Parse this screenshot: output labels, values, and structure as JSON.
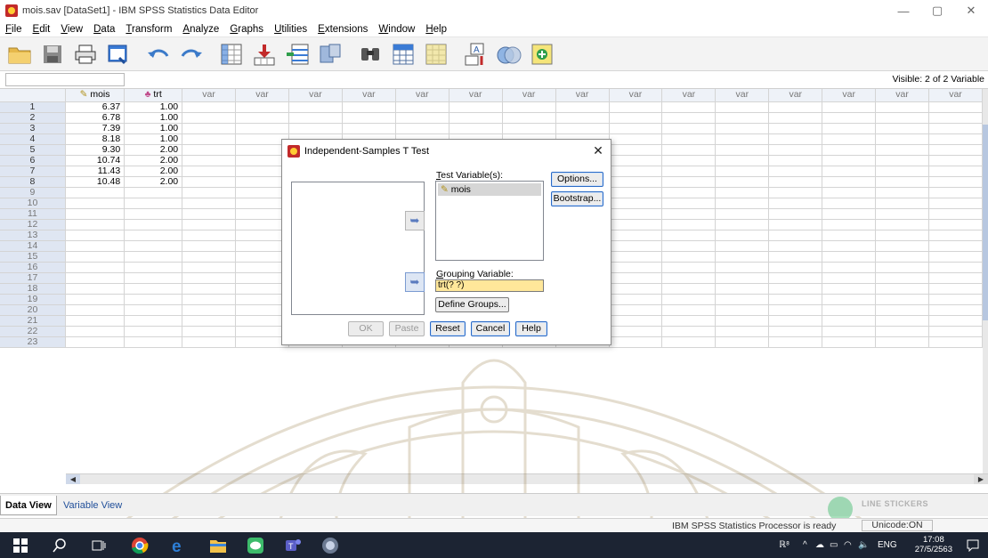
{
  "window": {
    "title": "mois.sav [DataSet1] - IBM SPSS Statistics Data Editor",
    "controls": {
      "minimize": "—",
      "maximize": "▢",
      "close": "✕"
    }
  },
  "menu": [
    "File",
    "Edit",
    "View",
    "Data",
    "Transform",
    "Analyze",
    "Graphs",
    "Utilities",
    "Extensions",
    "Window",
    "Help"
  ],
  "toolbar": [
    "open-folder-icon",
    "save-icon",
    "print-icon",
    "dialog-recall-icon",
    "undo-icon",
    "redo-icon",
    "goto-case-icon",
    "goto-variable-icon",
    "variables-icon",
    "run-descriptives-icon",
    "find-icon",
    "insert-cases-icon",
    "insert-variable-icon",
    "split-file-icon",
    "select-cases-icon",
    "value-labels-icon"
  ],
  "editor": {
    "visible": "Visible: 2 of 2 Variable"
  },
  "grid": {
    "columns": [
      {
        "label": "mois",
        "type": "scale"
      },
      {
        "label": "trt",
        "type": "nominal"
      },
      {
        "label": "var"
      },
      {
        "label": "var"
      },
      {
        "label": "var"
      },
      {
        "label": "var"
      },
      {
        "label": "var"
      },
      {
        "label": "var"
      },
      {
        "label": "var"
      },
      {
        "label": "var"
      },
      {
        "label": "var"
      },
      {
        "label": "var"
      },
      {
        "label": "var"
      },
      {
        "label": "var"
      },
      {
        "label": "var"
      },
      {
        "label": "var"
      },
      {
        "label": "var"
      }
    ],
    "rows": [
      [
        "6.37",
        "1.00"
      ],
      [
        "6.78",
        "1.00"
      ],
      [
        "7.39",
        "1.00"
      ],
      [
        "8.18",
        "1.00"
      ],
      [
        "9.30",
        "2.00"
      ],
      [
        "10.74",
        "2.00"
      ],
      [
        "11.43",
        "2.00"
      ],
      [
        "10.48",
        "2.00"
      ],
      [],
      [],
      [],
      [],
      [],
      [],
      [],
      [],
      [],
      [],
      [],
      [],
      [],
      [],
      []
    ]
  },
  "tabs": {
    "data_view": "Data View",
    "variable_view": "Variable View"
  },
  "status": {
    "processor": "IBM SPSS Statistics Processor is ready",
    "unicode": "Unicode:ON"
  },
  "sticker": {
    "brand": "LINE STICKERS"
  },
  "dialog": {
    "title": "Independent-Samples T Test",
    "test_label": "Test Variable(s):",
    "test_items": [
      "mois"
    ],
    "grouping_label": "Grouping Variable:",
    "grouping_value": "trt(? ?)",
    "define_groups": "Define Groups...",
    "options": "Options...",
    "bootstrap": "Bootstrap...",
    "ok": "OK",
    "paste": "Paste",
    "reset": "Reset",
    "cancel": "Cancel",
    "help": "Help",
    "close": "✕"
  },
  "taskbar": {
    "lang": "ENG",
    "time": "17:08",
    "date": "27/5/2563"
  }
}
